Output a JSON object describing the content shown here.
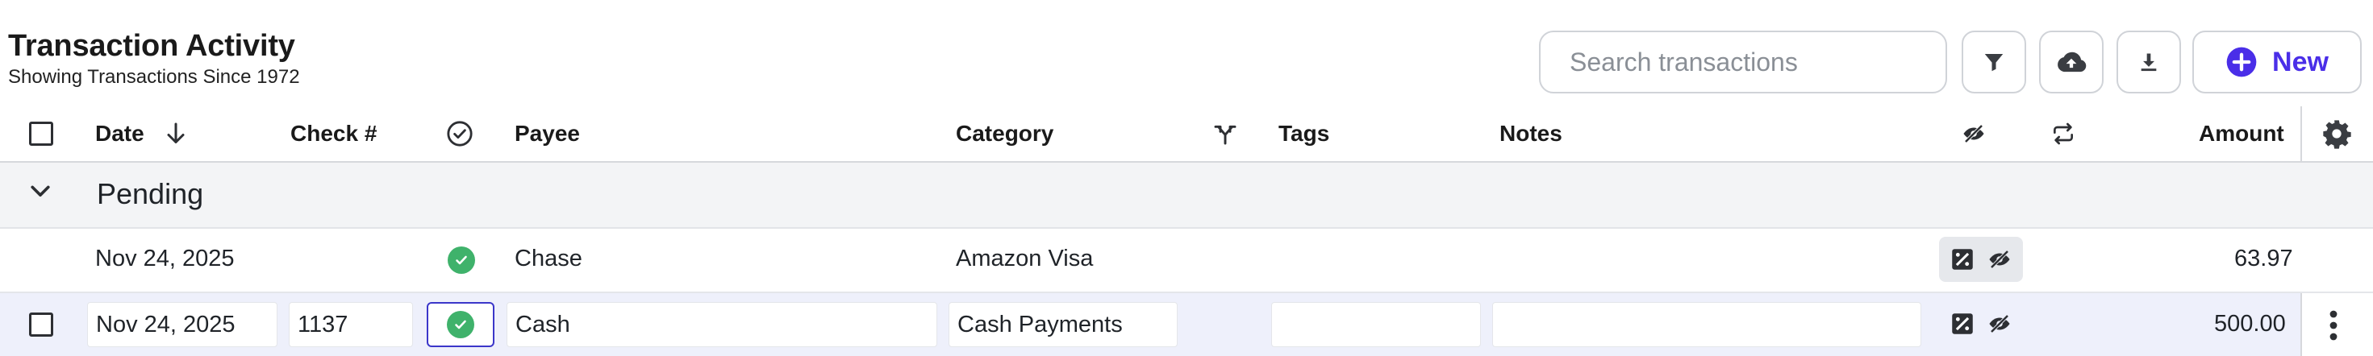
{
  "header": {
    "title": "Transaction Activity",
    "subtitle": "Showing Transactions Since 1972",
    "search_placeholder": "Search transactions",
    "new_label": "New"
  },
  "columns": {
    "date": "Date",
    "check": "Check #",
    "payee": "Payee",
    "category": "Category",
    "tags": "Tags",
    "notes": "Notes",
    "amount": "Amount"
  },
  "group": {
    "label": "Pending"
  },
  "rows": [
    {
      "date": "Nov 24, 2025",
      "check": "",
      "payee": "Chase",
      "category": "Amazon Visa",
      "amount": "63.97"
    },
    {
      "date": "Nov 24, 2025",
      "check": "1137",
      "payee": "Cash",
      "category": "Cash Payments",
      "amount": "500.00"
    }
  ],
  "colors": {
    "accent": "#4a2ee8",
    "cleared": "#3fb26b",
    "selected_row": "#eef0fb"
  }
}
